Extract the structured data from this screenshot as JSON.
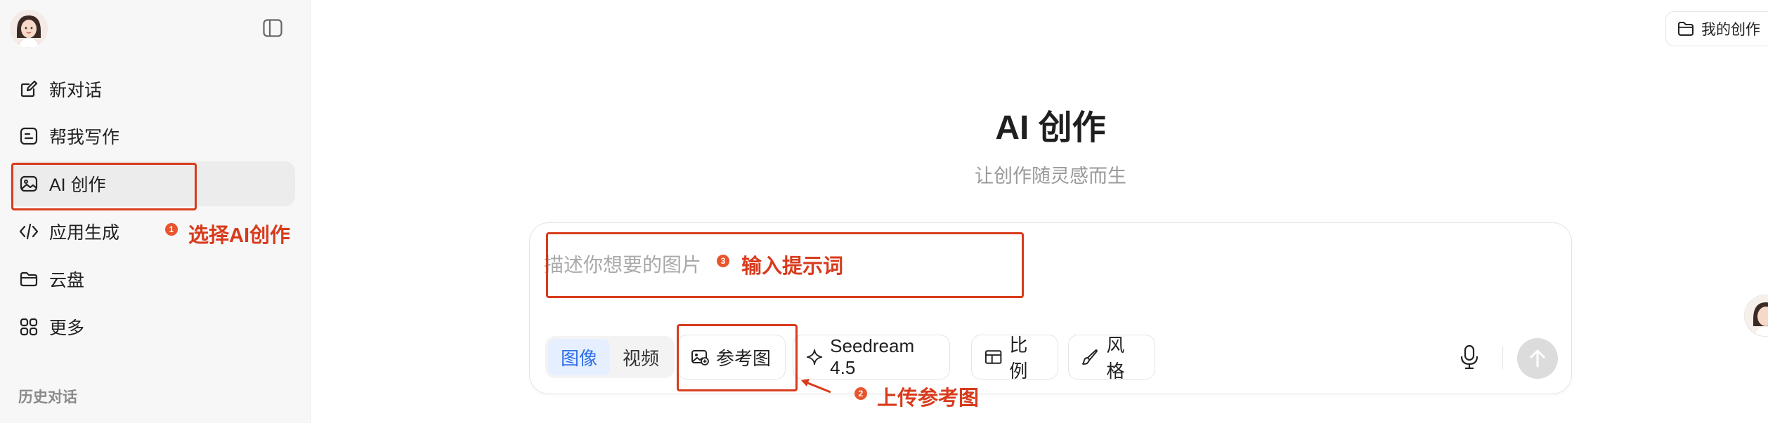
{
  "sidebar": {
    "items": [
      {
        "label": "新对话",
        "icon": "edit-icon"
      },
      {
        "label": "帮我写作",
        "icon": "writing-icon"
      },
      {
        "label": "AI 创作",
        "icon": "image-icon",
        "active": true
      },
      {
        "label": "应用生成",
        "icon": "code-icon"
      },
      {
        "label": "云盘",
        "icon": "folder-icon"
      },
      {
        "label": "更多",
        "icon": "grid-icon"
      }
    ],
    "history_title": "历史对话"
  },
  "header": {
    "my_creations": "我的创作"
  },
  "main": {
    "title": "AI 创作",
    "subtitle": "让创作随灵感而生",
    "prompt_placeholder": "描述你想要的图片",
    "modes": [
      "图像",
      "视频"
    ],
    "active_mode": "图像",
    "tools": {
      "reference": "参考图",
      "model": "Seedream 4.5",
      "ratio": "比例",
      "style": "风格"
    }
  },
  "annotations": {
    "step1": {
      "num": "1",
      "text": "选择AI创作"
    },
    "step2": {
      "num": "2",
      "text": "上传参考图"
    },
    "step3": {
      "num": "3",
      "text": "输入提示词"
    }
  },
  "colors": {
    "accent_blue": "#2f6fed",
    "annotation_red": "#d83b1c",
    "sidebar_bg": "#f7f7f8"
  }
}
